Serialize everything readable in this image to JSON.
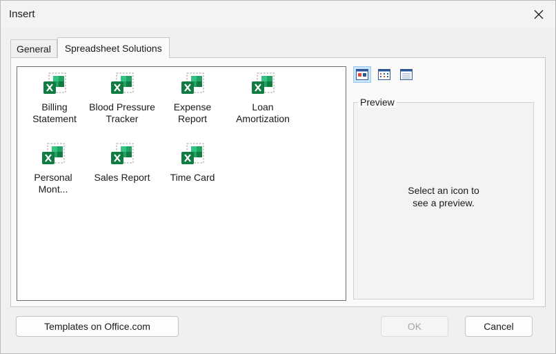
{
  "window": {
    "title": "Insert"
  },
  "tabs": [
    {
      "label": "General",
      "active": false
    },
    {
      "label": "Spreadsheet Solutions",
      "active": true
    }
  ],
  "templates": [
    {
      "line1": "Billing",
      "line2": "Statement",
      "icon": "excel-template-icon"
    },
    {
      "line1": "Blood Pressure",
      "line2": "Tracker",
      "icon": "excel-template-icon"
    },
    {
      "line1": "Expense",
      "line2": "Report",
      "icon": "excel-template-icon"
    },
    {
      "line1": "Loan",
      "line2": "Amortization",
      "icon": "excel-template-icon"
    },
    {
      "line1": "Personal",
      "line2": "Mont...",
      "icon": "excel-template-icon"
    },
    {
      "line1": "Sales Report",
      "line2": "",
      "icon": "excel-template-icon"
    },
    {
      "line1": "Time Card",
      "line2": "",
      "icon": "excel-template-icon"
    }
  ],
  "view_buttons": [
    {
      "icon": "large-icons-view-icon",
      "active": true
    },
    {
      "icon": "list-view-icon",
      "active": false
    },
    {
      "icon": "details-view-icon",
      "active": false
    }
  ],
  "preview": {
    "legend": "Preview",
    "line1": "Select an icon to",
    "line2": "see a preview."
  },
  "buttons": {
    "templates_online": "Templates on Office.com",
    "ok": "OK",
    "cancel": "Cancel"
  },
  "colors": {
    "excel_dark": "#107c41",
    "excel_mid": "#21a366",
    "excel_light": "#33c481",
    "selection": "#cce4f7"
  }
}
